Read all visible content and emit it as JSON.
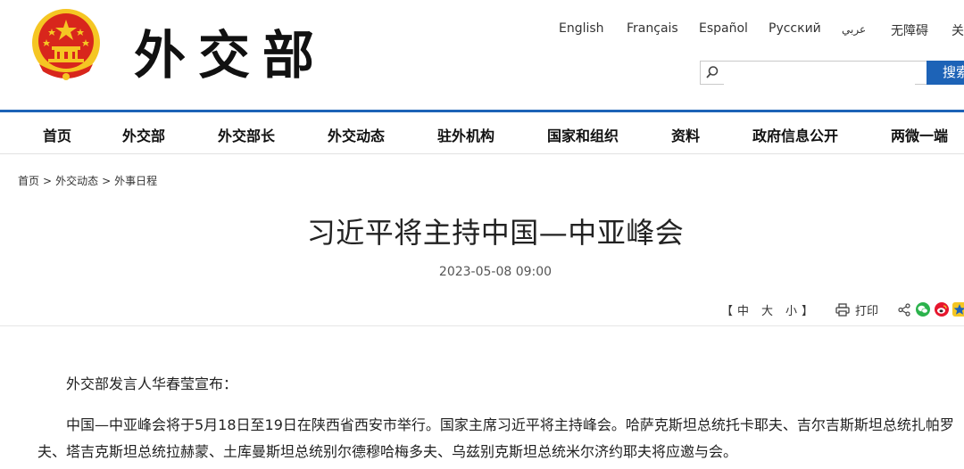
{
  "header": {
    "calligraphy_text": "外交部",
    "languages": [
      "English",
      "Français",
      "Español",
      "Русский",
      "عربي",
      "无障碍",
      "关"
    ],
    "search": {
      "placeholder": "",
      "button_label": "搜索"
    }
  },
  "nav": {
    "items": [
      "首页",
      "外交部",
      "外交部长",
      "外交动态",
      "驻外机构",
      "国家和组织",
      "资料",
      "政府信息公开",
      "两微一端"
    ]
  },
  "breadcrumb": [
    "首页",
    "外交动态",
    "外事日程"
  ],
  "breadcrumb_sep": ">",
  "article": {
    "title": "习近平将主持中国—中亚峰会",
    "date": "2023-05-08 09:00",
    "font_bracket_open": "【",
    "font_small": "中",
    "font_medium": "大",
    "font_large": "小",
    "font_bracket_close": "】",
    "print_label": "打印",
    "paragraphs": [
      "外交部发言人华春莹宣布：",
      "中国—中亚峰会将于5月18日至19日在陕西省西安市举行。国家主席习近平将主持峰会。哈萨克斯坦总统托卡耶夫、吉尔吉斯斯坦总统扎帕罗夫、塔吉克斯坦总统拉赫蒙、土库曼斯坦总统别尔德穆哈梅多夫、乌兹别克斯坦总统米尔济约耶夫将应邀与会。"
    ]
  },
  "colors": {
    "brand_blue": "#1d63b7",
    "emblem_red": "#d8261c",
    "emblem_gold": "#f5c623"
  }
}
